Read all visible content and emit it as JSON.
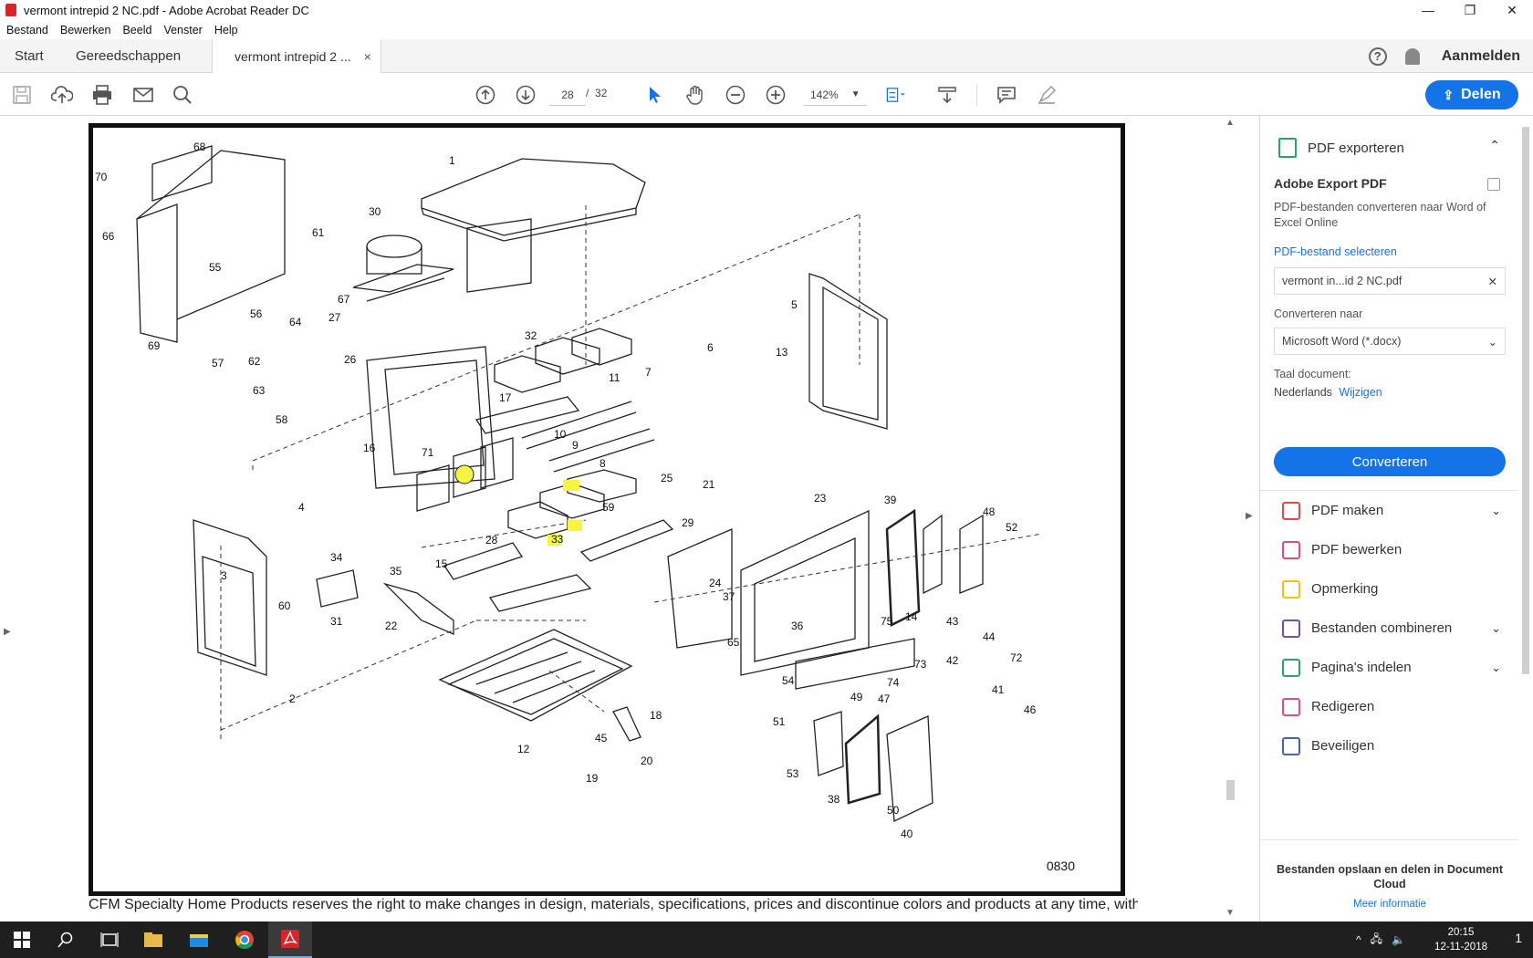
{
  "window": {
    "title": "vermont intrepid 2 NC.pdf - Adobe Acrobat Reader DC",
    "minimize": "—",
    "restore": "❐",
    "close": "✕"
  },
  "menu": [
    "Bestand",
    "Bewerken",
    "Beeld",
    "Venster",
    "Help"
  ],
  "tabs": {
    "start": "Start",
    "tools": "Gereedschappen",
    "doc": "vermont intrepid 2 ...",
    "doc_close": "×"
  },
  "account": {
    "help": "?",
    "signin": "Aanmelden"
  },
  "toolbar": {
    "page_current": "28",
    "page_sep": "/",
    "page_total": "32",
    "zoom": "142%",
    "share": "Delen"
  },
  "document": {
    "plate": "0830",
    "footnote": "CFM Specialty Home Products reserves the right to make changes in design, materials, specifications, prices and discontinue colors and products at any time, without notice.",
    "callouts": [
      "1",
      "2",
      "3",
      "4",
      "5",
      "6",
      "7",
      "8",
      "9",
      "10",
      "11",
      "12",
      "13",
      "14",
      "15",
      "16",
      "17",
      "18",
      "19",
      "20",
      "21",
      "22",
      "23",
      "24",
      "25",
      "26",
      "27",
      "28",
      "29",
      "30",
      "31",
      "32",
      "33",
      "34",
      "35",
      "36",
      "37",
      "38",
      "39",
      "40",
      "41",
      "42",
      "43",
      "44",
      "45",
      "46",
      "47",
      "48",
      "49",
      "50",
      "51",
      "52",
      "53",
      "54",
      "55",
      "56",
      "57",
      "58",
      "59",
      "60",
      "61",
      "62",
      "63",
      "64",
      "65",
      "66",
      "67",
      "68",
      "69",
      "70",
      "71",
      "72",
      "73",
      "74",
      "75"
    ],
    "highlighted": [
      "31",
      "32",
      "33"
    ]
  },
  "right_panel": {
    "export_title": "PDF exporteren",
    "aep_title": "Adobe Export PDF",
    "aep_desc": "PDF-bestanden converteren naar Word of Excel Online",
    "select_file": "PDF-bestand selecteren",
    "file_name": "vermont in...id 2 NC.pdf",
    "convert_to_label": "Converteren naar",
    "convert_to_value": "Microsoft Word (*.docx)",
    "language_label": "Taal document:",
    "language_value": "Nederlands",
    "language_change": "Wijzigen",
    "convert_button": "Converteren",
    "tools": [
      {
        "label": "PDF maken",
        "color": "#e34850",
        "chev": true
      },
      {
        "label": "PDF bewerken",
        "color": "#e34a8a",
        "chev": false
      },
      {
        "label": "Opmerking",
        "color": "#f2c40f",
        "chev": false
      },
      {
        "label": "Bestanden combineren",
        "color": "#6b4fbb",
        "chev": true
      },
      {
        "label": "Pagina's indelen",
        "color": "#2da36a",
        "chev": true
      },
      {
        "label": "Redigeren",
        "color": "#e34a8a",
        "chev": false
      },
      {
        "label": "Beveiligen",
        "color": "#4c5fb8",
        "chev": false
      }
    ],
    "footer_text": "Bestanden opslaan en delen in Document Cloud",
    "footer_link": "Meer informatie"
  },
  "taskbar": {
    "time": "20:15",
    "date": "12-11-2018",
    "notifications": "1"
  },
  "colors": {
    "accent": "#1473e6",
    "highlight": "#f5f542"
  }
}
